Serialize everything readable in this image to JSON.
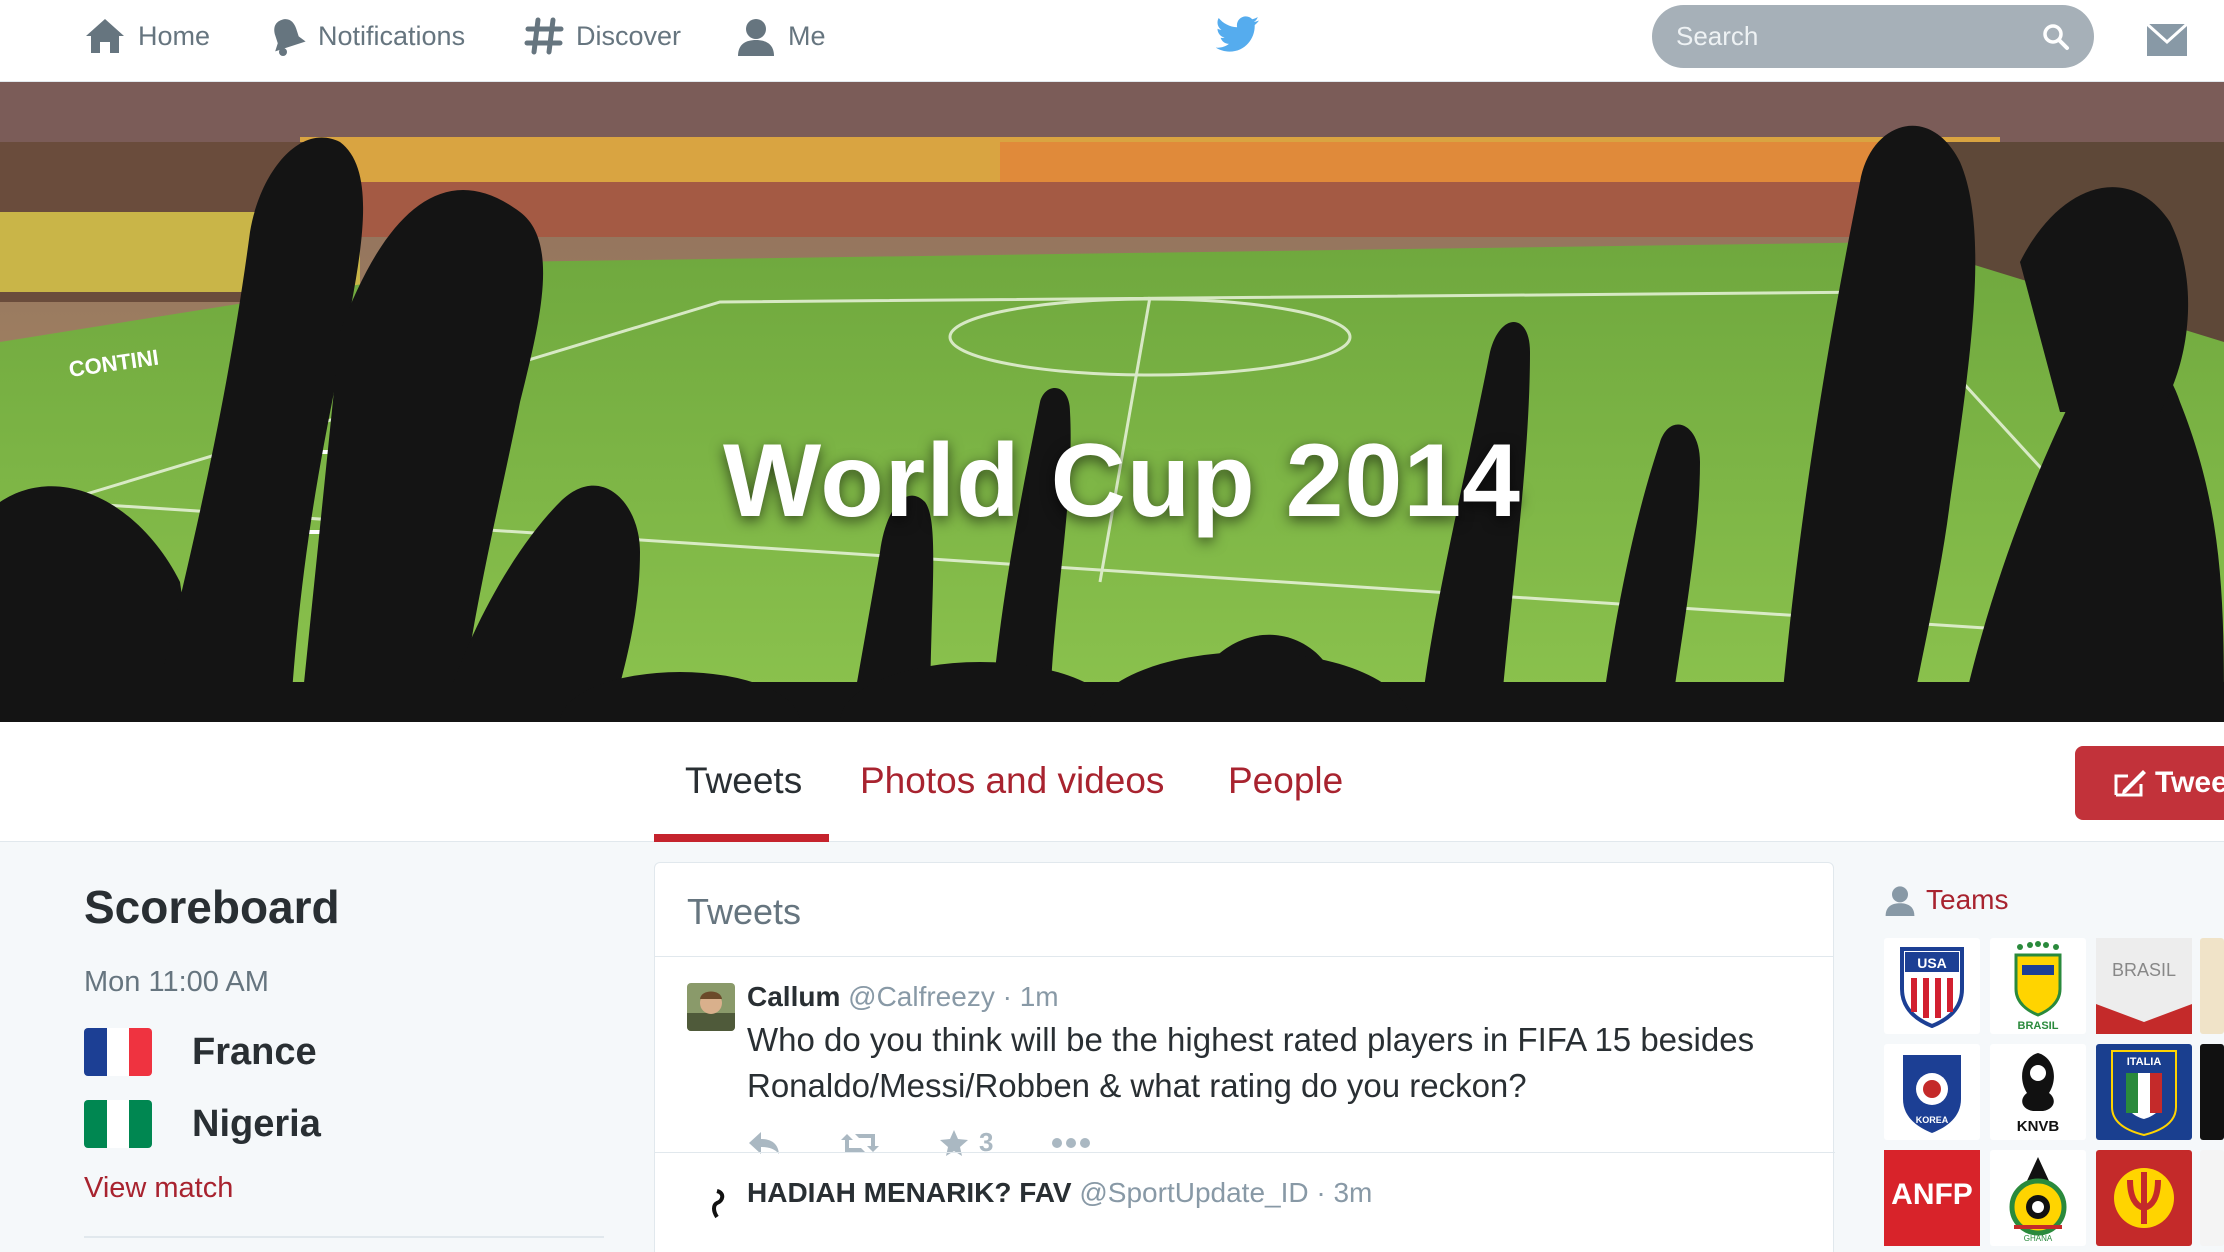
{
  "nav": {
    "home_label": "Home",
    "notifications_label": "Notifications",
    "discover_label": "Discover",
    "me_label": "Me",
    "search_placeholder": "Search"
  },
  "banner": {
    "title": "World Cup 2014"
  },
  "tabs": [
    {
      "label": "Tweets",
      "active": true
    },
    {
      "label": "Photos and videos",
      "active": false
    },
    {
      "label": "People",
      "active": false
    }
  ],
  "tweet_button_label": "Tweet",
  "scoreboard": {
    "title": "Scoreboard",
    "time": "Mon 11:00 AM",
    "teams": [
      {
        "name": "France",
        "colors": [
          "#1c3f94",
          "#ffffff",
          "#ef3340"
        ]
      },
      {
        "name": "Nigeria",
        "colors": [
          "#008751",
          "#ffffff",
          "#008751"
        ]
      }
    ],
    "link": "View match"
  },
  "tweets_panel": {
    "header": "Tweets",
    "tweets": [
      {
        "name": "Callum",
        "handle": "@Calfreezy",
        "time": "· 1m",
        "text": "Who do you think will be the highest rated players in FIFA 15 besides Ronaldo/Messi/Robben & what rating do you reckon?",
        "favorites": "3"
      },
      {
        "name": "HADIAH MENARIK? FAV",
        "handle": "@SportUpdate_ID",
        "time": "· 3m",
        "text": "",
        "favorites": ""
      }
    ]
  },
  "teams_section": {
    "title": "Teams",
    "badges": [
      "USA",
      "BRASIL",
      "BRASIL",
      "KOREA",
      "KNVB",
      "ITALIA",
      "ANFP",
      "GHANA",
      "BELGIUM"
    ]
  },
  "colors": {
    "accent": "#c5232d",
    "link": "#a8232f",
    "twitter_blue": "#55acee"
  }
}
